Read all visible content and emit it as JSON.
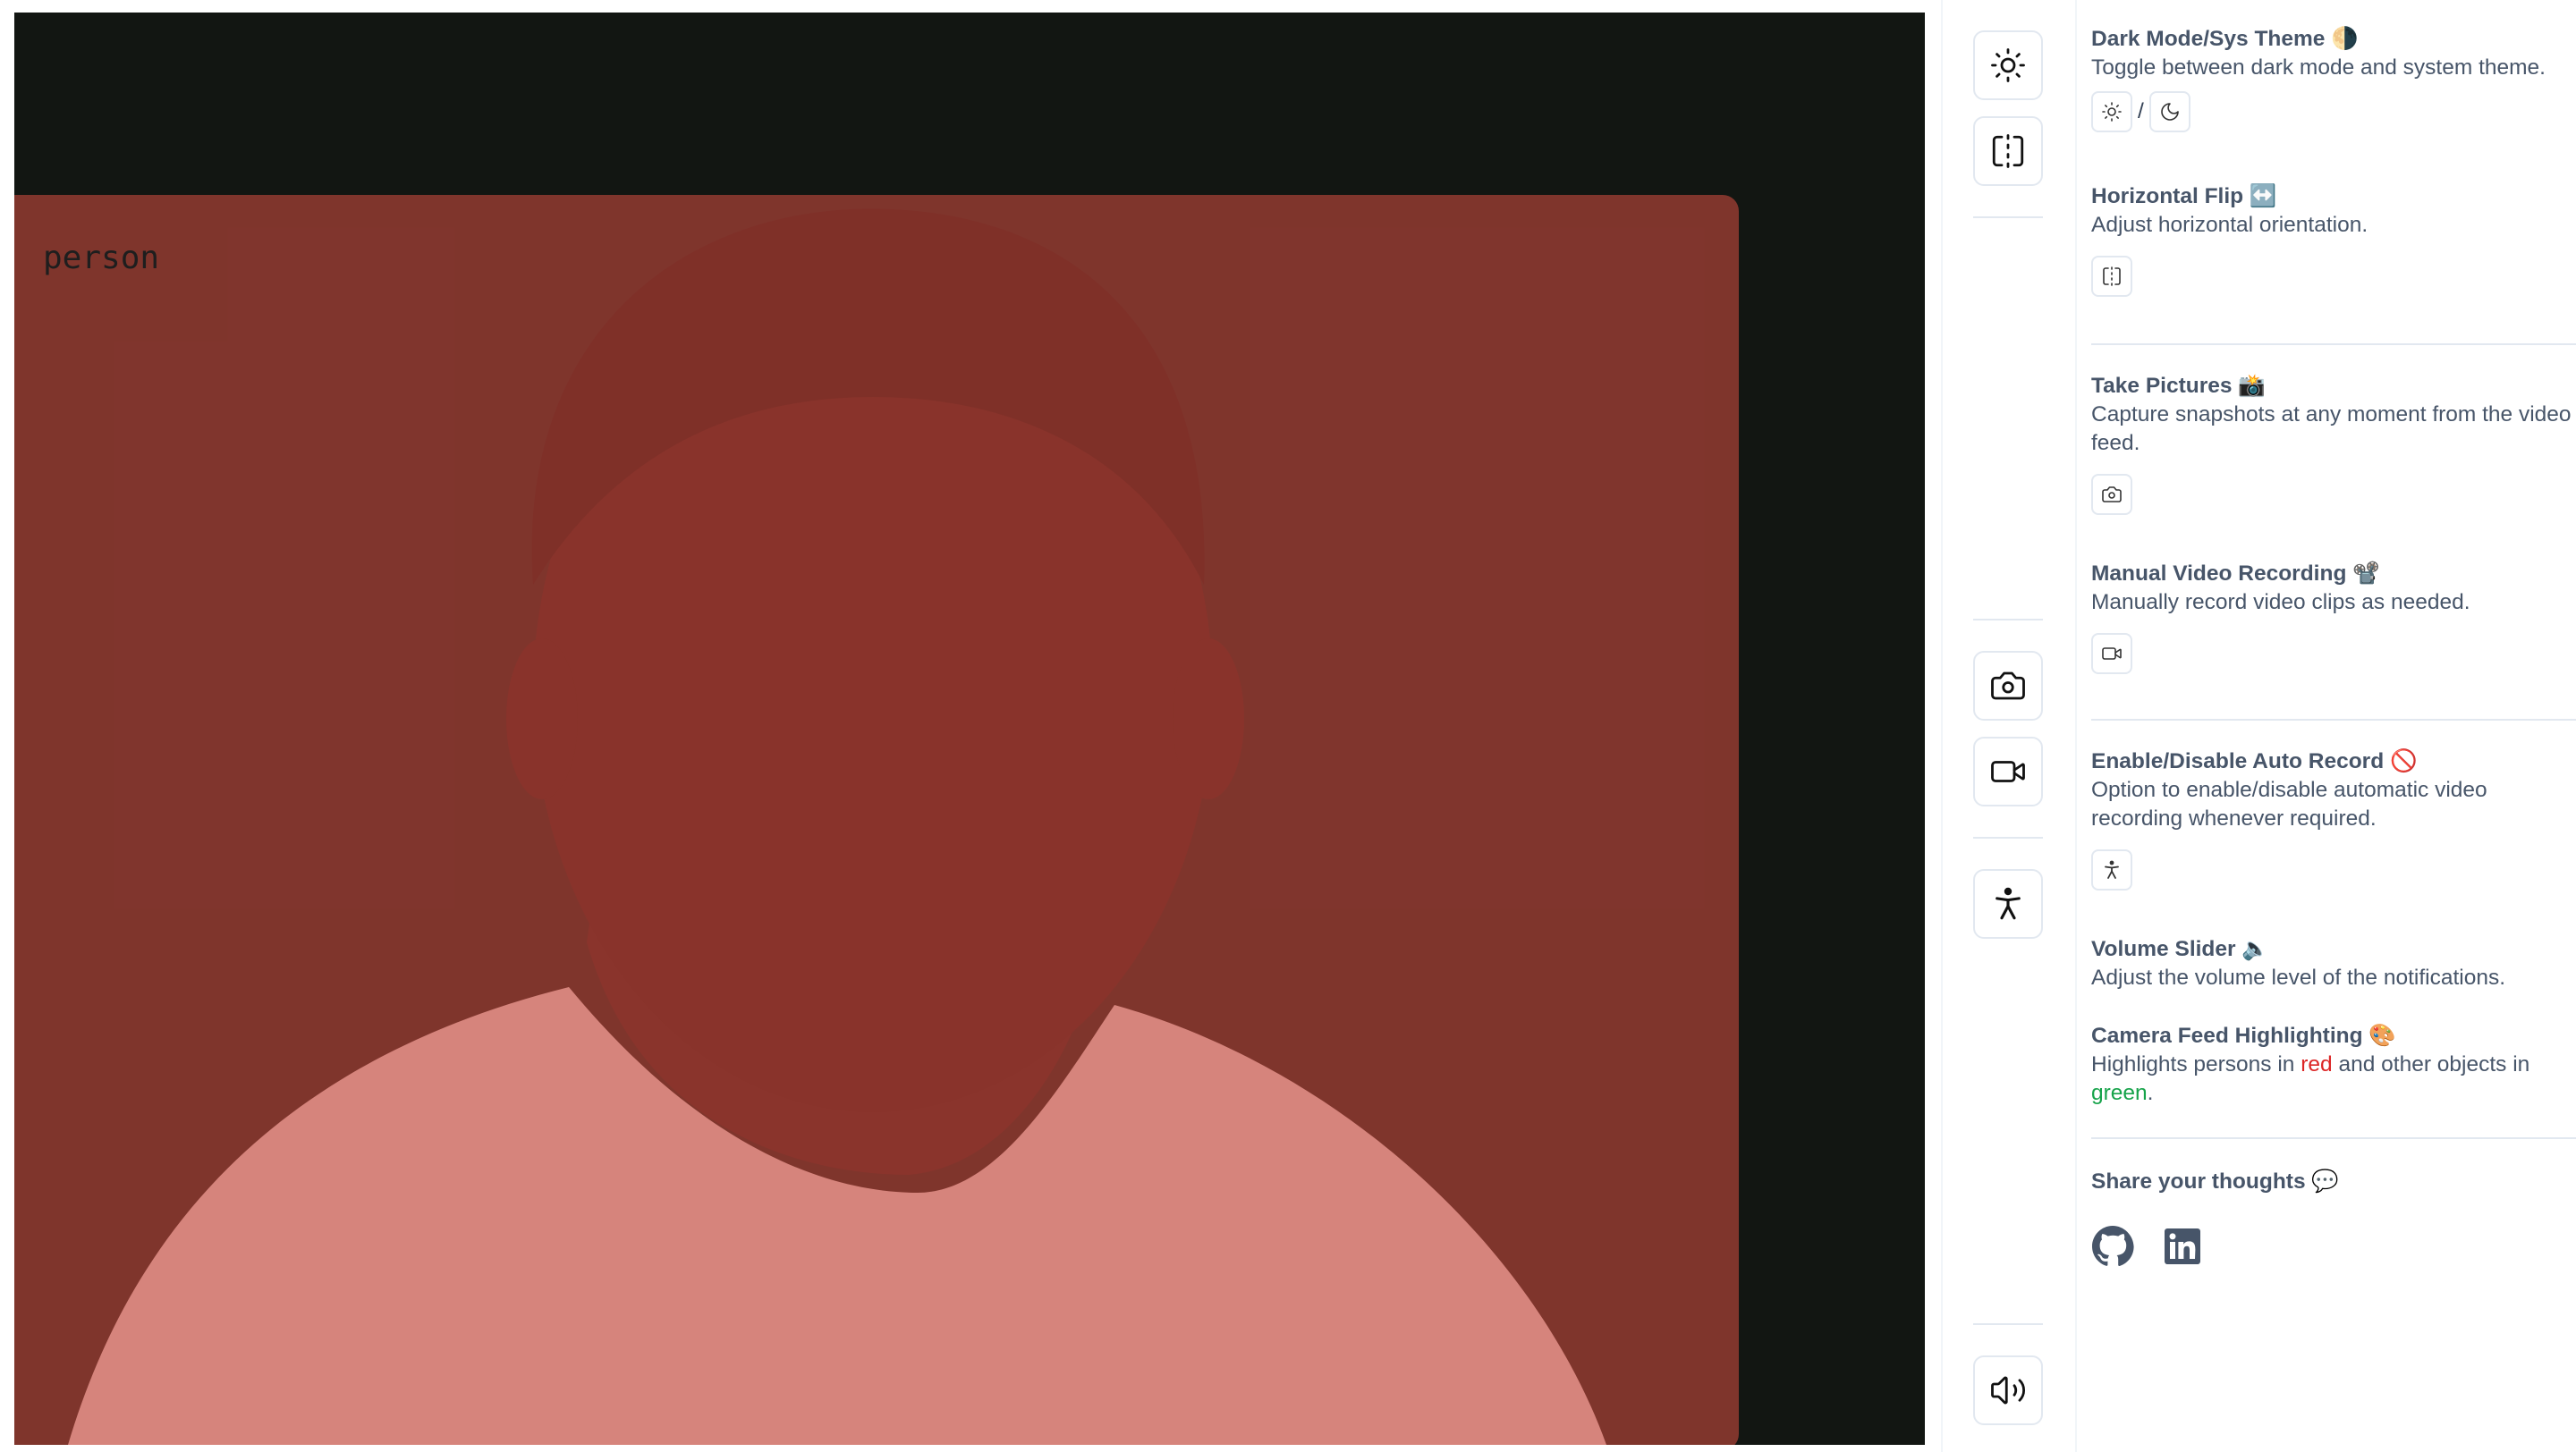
{
  "feed": {
    "detection_label": "person",
    "highlight_color": "#c4483e"
  },
  "toolbar": {
    "buttons": [
      {
        "icon": "sun-icon"
      },
      {
        "icon": "flip-horizontal-icon"
      },
      {
        "icon": "camera-icon"
      },
      {
        "icon": "video-icon"
      },
      {
        "icon": "accessibility-person-icon"
      },
      {
        "icon": "volume-icon"
      }
    ]
  },
  "panel": {
    "dark_mode": {
      "title": "Dark Mode/Sys Theme 🌗",
      "desc": "Toggle between dark mode and system theme.",
      "separator": "/"
    },
    "flip": {
      "title": "Horizontal Flip ↔️",
      "desc": "Adjust horizontal orientation."
    },
    "pictures": {
      "title": "Take Pictures 📸",
      "desc": "Capture snapshots at any moment from the video feed."
    },
    "recording": {
      "title": "Manual Video Recording 📽️",
      "desc": "Manually record video clips as needed."
    },
    "auto_record": {
      "title": "Enable/Disable Auto Record 🚫",
      "desc": "Option to enable/disable automatic video recording whenever required."
    },
    "volume": {
      "title": "Volume Slider 🔈",
      "desc": "Adjust the volume level of the notifications."
    },
    "highlighting": {
      "title": "Camera Feed Highlighting 🎨",
      "desc_part1": "Highlights persons in ",
      "red_word": "red",
      "desc_part2": " and other objects in ",
      "green_word": "green",
      "desc_end": "."
    },
    "thoughts": {
      "title": "Share your thoughts 💬"
    }
  },
  "colors": {
    "accent_red": "#dc2626",
    "accent_green": "#16a34a",
    "border": "#e2e8f0",
    "text": "#475569"
  }
}
